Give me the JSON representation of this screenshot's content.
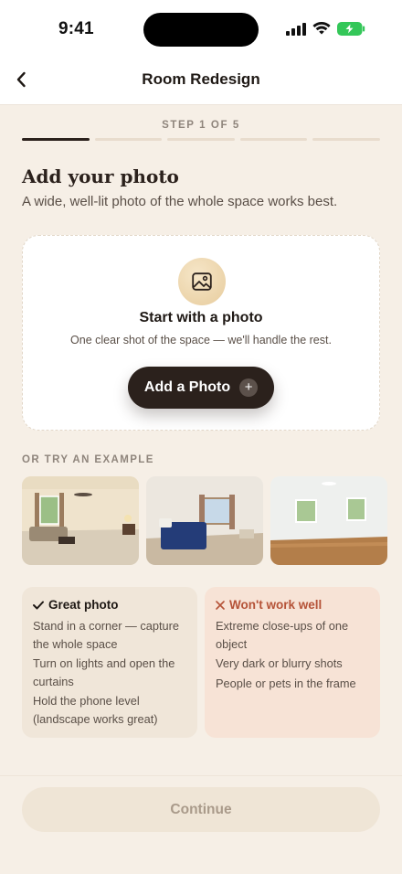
{
  "status_bar": {
    "time": "9:41"
  },
  "header": {
    "title": "Room Redesign"
  },
  "progress": {
    "label": "STEP 1 OF 5",
    "current_step": 1,
    "total_steps": 5
  },
  "intro": {
    "title": "Add your photo",
    "subtitle": "A wide, well-lit photo of the whole space works best."
  },
  "upload": {
    "icon": "image-icon",
    "title": "Start with a photo",
    "description": "One clear shot of the space — we'll handle the rest.",
    "button_label": "Add a Photo",
    "button_icon": "plus-icon"
  },
  "examples": {
    "label": "OR TRY AN EXAMPLE",
    "items": [
      {
        "name": "example-living-room"
      },
      {
        "name": "example-bedroom"
      },
      {
        "name": "example-empty-room"
      }
    ]
  },
  "tips": {
    "good": {
      "heading": "Great photo",
      "icon": "check-icon",
      "items": [
        "Stand in a corner — capture the whole space",
        "Turn on lights and open the curtains",
        "Hold the phone level (landscape works great)"
      ]
    },
    "bad": {
      "heading": "Won't work well",
      "icon": "x-icon",
      "items": [
        "Extreme close-ups of one object",
        "Very dark or blurry shots",
        "People or pets in the frame"
      ]
    }
  },
  "footer": {
    "continue_label": "Continue"
  },
  "colors": {
    "background": "#f6efe6",
    "primary": "#2b211c",
    "accent_warm": "#e7cc9d",
    "warning": "#b55338"
  }
}
